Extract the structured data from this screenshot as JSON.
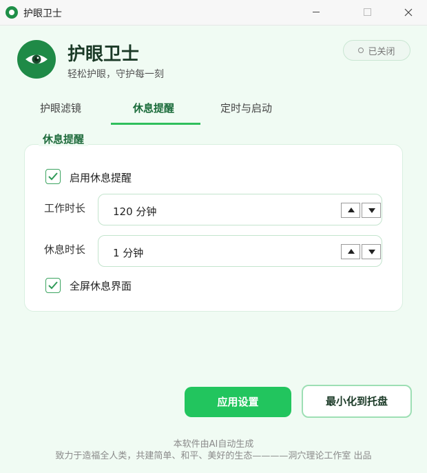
{
  "window": {
    "title": "护眼卫士"
  },
  "header": {
    "app_name": "护眼卫士",
    "slogan": "轻松护眼，守护每一刻",
    "status": "已关闭",
    "accent_color": "#22c55e"
  },
  "tabs": [
    {
      "label": "护眼滤镜",
      "active": false
    },
    {
      "label": "休息提醒",
      "active": true
    },
    {
      "label": "定时与启动",
      "active": false
    }
  ],
  "rest_panel": {
    "title": "休息提醒",
    "enable_label": "启用休息提醒",
    "enable_checked": true,
    "work_label": "工作时长",
    "work_value": "120 分钟",
    "rest_label": "休息时长",
    "rest_value": "1 分钟",
    "fullscreen_label": "全屏休息界面",
    "fullscreen_checked": true
  },
  "actions": {
    "apply": "应用设置",
    "tray": "最小化到托盘"
  },
  "footer": {
    "line1": "本软件由AI自动生成",
    "line2": "致力于造福全人类，共建简单、和平、美好的生态————洞穴理论工作室 出品"
  }
}
